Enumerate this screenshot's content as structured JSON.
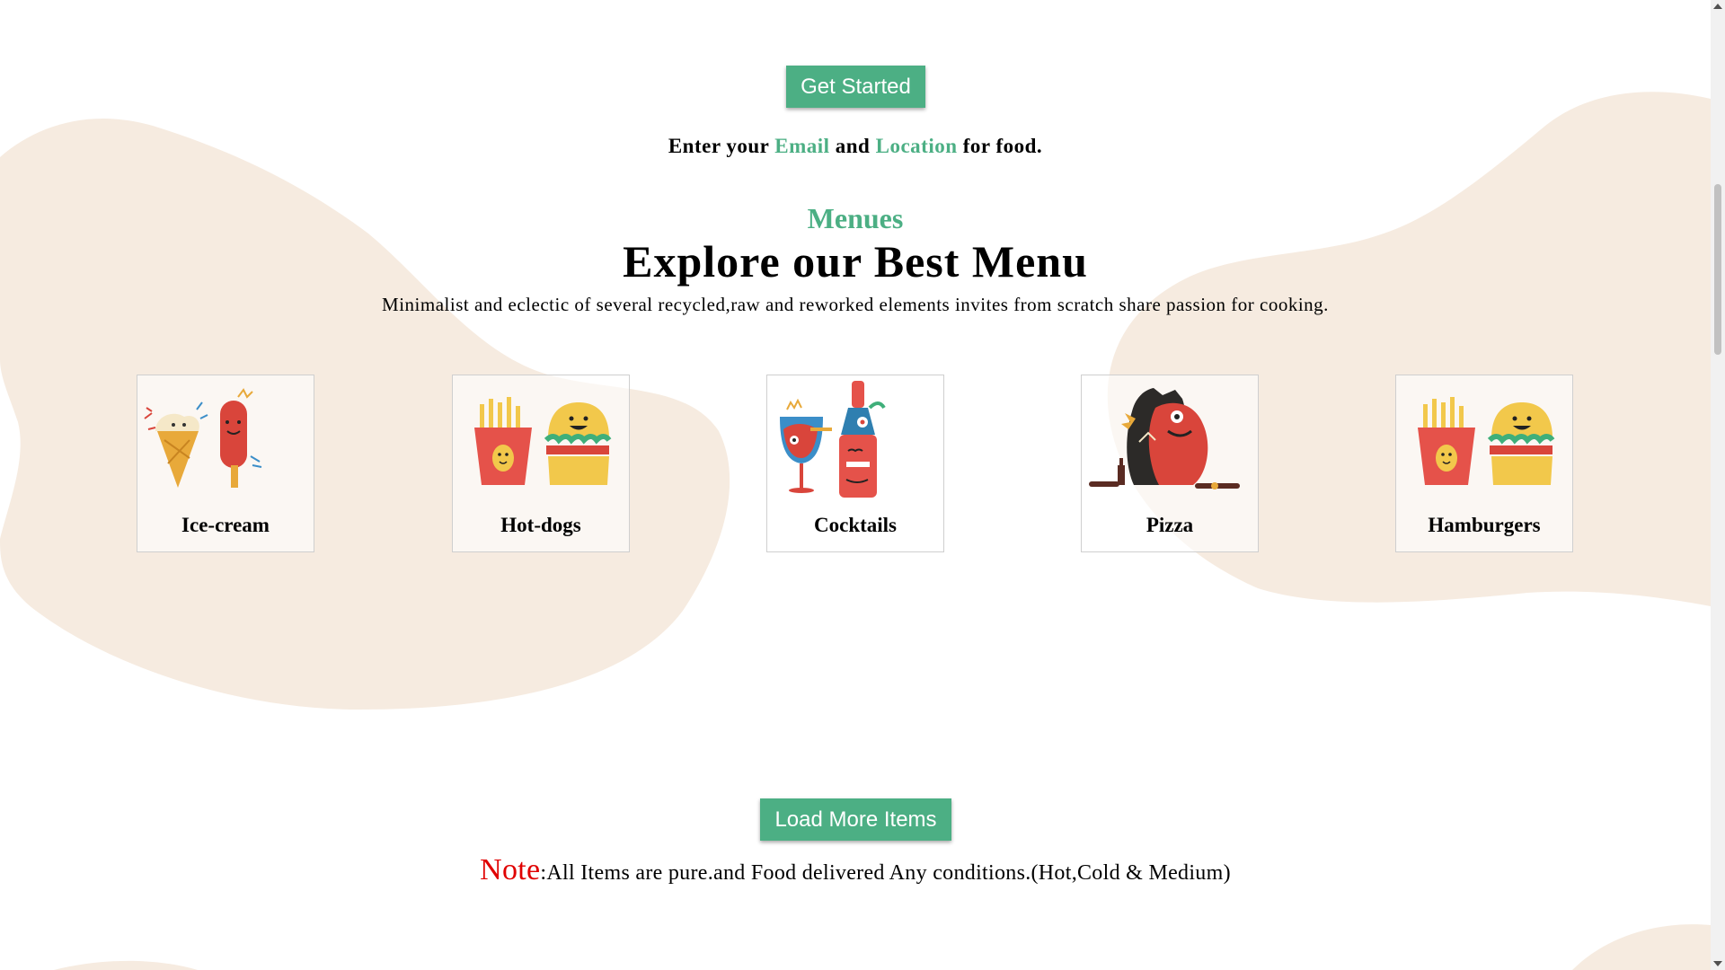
{
  "hero": {
    "get_started_label": "Get Started"
  },
  "enter_line": {
    "prefix": "Enter your ",
    "email": "Email",
    "and": " and ",
    "location": "Location",
    "suffix": " for food."
  },
  "menu_section": {
    "eyebrow": "Menues",
    "title": "Explore our Best Menu",
    "subtitle": "Minimalist and eclectic of several recycled,raw and reworked elements invites from scratch share passion for cooking."
  },
  "menu_items": [
    {
      "label": "Ice-cream",
      "icon": "ice-cream-icon"
    },
    {
      "label": "Hot-dogs",
      "icon": "fries-burger-icon"
    },
    {
      "label": "Cocktails",
      "icon": "cocktail-bottle-icon"
    },
    {
      "label": "Pizza",
      "icon": "pizza-monsters-icon"
    },
    {
      "label": "Hamburgers",
      "icon": "fries-burger-icon"
    }
  ],
  "load_more_label": "Load More Items",
  "note": {
    "word": "Note",
    "text": ":All Items are pure.and Food delivered Any conditions.(Hot,Cold & Medium)"
  },
  "colors": {
    "accent": "#4caf84",
    "blob": "#f6ebe0",
    "note": "#e00000"
  }
}
